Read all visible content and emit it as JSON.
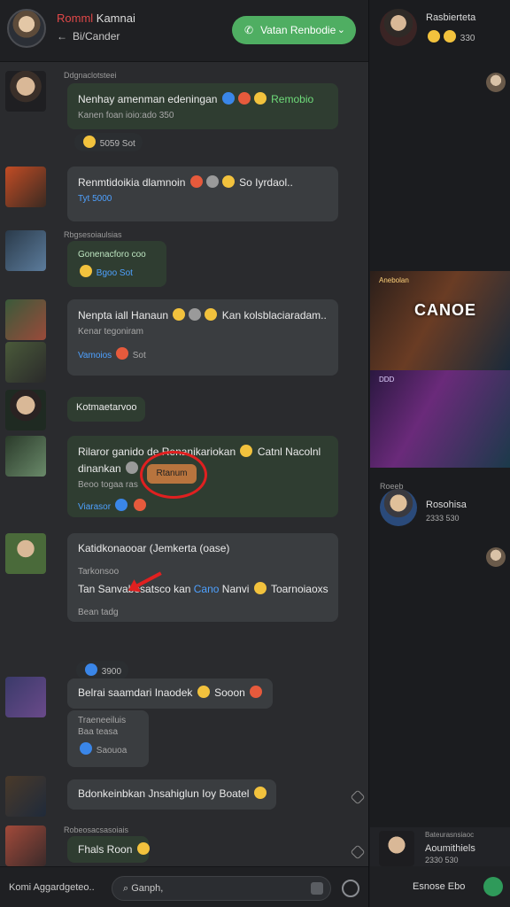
{
  "header": {
    "name_accent": "Romml",
    "name_rest": " Kamnai",
    "back_label": "←",
    "subtitle": "Bi/Cander",
    "action_button": "Vatan Renbodie",
    "action_icon": "phone-icon",
    "action_chevron": "⌄"
  },
  "messages": [
    {
      "meta": "Ddgnaclotsteei",
      "text": "Nenhay amenman edeningan",
      "extra": "Remobio",
      "sub": "Kanen foan ioio:ado 350",
      "react": "5059 Sot"
    },
    {
      "meta": "",
      "text": "Renmtidoikia dlamnoin",
      "extra": "So Iyrdaol..",
      "sub": "Tyt 5000"
    },
    {
      "meta": "Rbgsesoiaulsias",
      "text": "Gonenacforo coo",
      "react": "Bgoo Sot"
    },
    {
      "meta": "",
      "text": "Nenpta iall Hanaun",
      "extra": "Kan kolsblaciaradam..",
      "sub": "Kenar tegoniram",
      "react_link": "Vamoios",
      "react": "Sot"
    },
    {
      "meta": "",
      "text": "Kotmaetarvoo",
      "pill": "Rtanum"
    },
    {
      "meta": "",
      "text": "Rilaror ganido de",
      "extra": "Renanikariokan",
      "extra2": "Catnl Nacolnl",
      "text2": "dinankan",
      "sub": "Beoo togaa ras",
      "react_link": "Viarasor"
    },
    {
      "meta": "",
      "text": "Katidkonaooar (Jemkerta (oase)",
      "sub": "Tarkonsoo",
      "text2": "Tan Sanvabesatsco kan",
      "mid": "Cano",
      "extra": "Nanvi",
      "extra2": "Toarnoiaoxs",
      "sub2": "Bean tadg",
      "react": "3900"
    },
    {
      "meta": "",
      "text": "Belrai saamdari Inaodek",
      "gtext": "Inaedek",
      "extra": "Sooon",
      "sub": "Traeneeiluis",
      "sub2": "Baa teasa",
      "react": "Saouoa"
    },
    {
      "meta": "",
      "text": "Bdonkeinbkan Jnsahiglun Ioy Boatel"
    },
    {
      "meta": "Robeosacsasoiais",
      "text": "Fhals Roon"
    }
  ],
  "composer": {
    "label": "Komi Aggardgeteo..",
    "placeholder": "Ganph,",
    "gif_icon": "gif-icon",
    "emoji_icon": "emoji-icon"
  },
  "right": {
    "user_name": "Rasbierteta",
    "user_stat": "330",
    "banner_title": "CANOE",
    "banner_tag": "Anebolan",
    "banner_tag2": "DDD",
    "card_meta": "Roeeb",
    "card_name": "Rosohisa",
    "card_stat": "2333 530",
    "bottom_meta": "Bateurasnsiaoc",
    "bottom_name": "Aoumithiels",
    "bottom_stat": "2330 530",
    "compose_label": "Esnose Ebo"
  }
}
